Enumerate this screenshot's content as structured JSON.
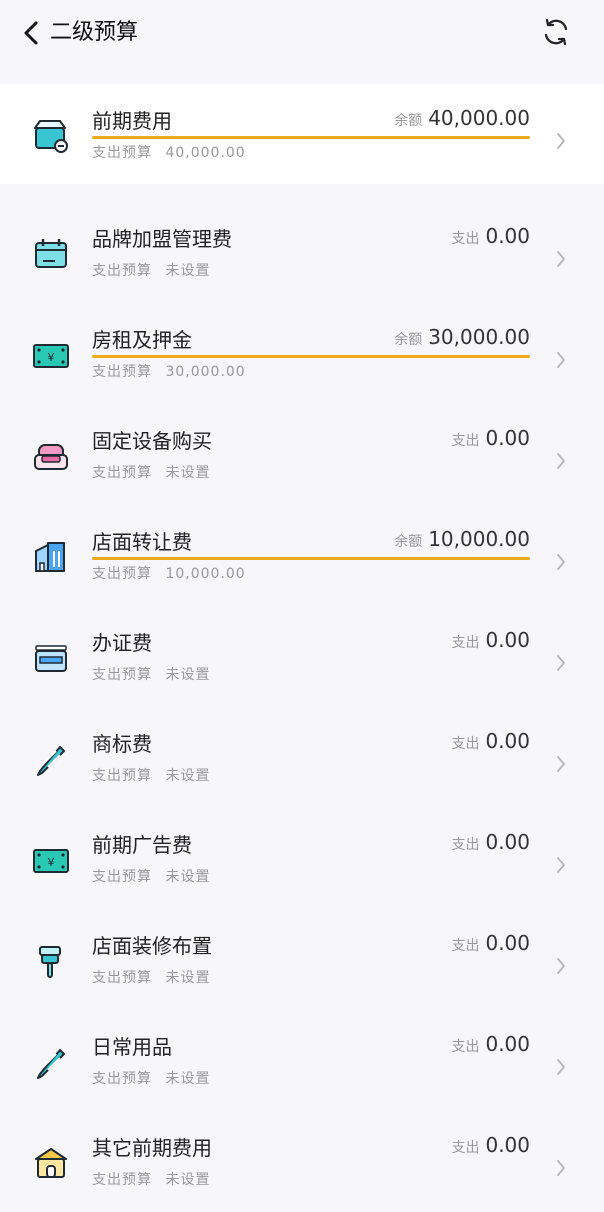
{
  "header": {
    "title": "二级预算"
  },
  "items": [
    {
      "name": "前期费用",
      "label": "余额",
      "amount": "40,000.00",
      "sub_label": "支出预算",
      "sub_value": "40,000.00",
      "has_progress": true,
      "progress": 1.0,
      "icon": "shop-icon",
      "color": "#38c6d3"
    },
    {
      "name": "品牌加盟管理费",
      "label": "支出",
      "amount": "0.00",
      "sub_label": "支出预算",
      "sub_value": "未设置",
      "has_progress": false,
      "icon": "calendar-icon",
      "color": "#38c6d3"
    },
    {
      "name": "房租及押金",
      "label": "余额",
      "amount": "30,000.00",
      "sub_label": "支出预算",
      "sub_value": "30,000.00",
      "has_progress": true,
      "progress": 1.0,
      "icon": "money-bill-icon",
      "color": "#29c9b6"
    },
    {
      "name": "固定设备购买",
      "label": "支出",
      "amount": "0.00",
      "sub_label": "支出预算",
      "sub_value": "未设置",
      "has_progress": false,
      "icon": "sofa-icon",
      "color": "#e86aa2"
    },
    {
      "name": "店面转让费",
      "label": "余额",
      "amount": "10,000.00",
      "sub_label": "支出预算",
      "sub_value": "10,000.00",
      "has_progress": true,
      "progress": 1.0,
      "icon": "building-icon",
      "color": "#4aa6f2"
    },
    {
      "name": "办证费",
      "label": "支出",
      "amount": "0.00",
      "sub_label": "支出预算",
      "sub_value": "未设置",
      "has_progress": false,
      "icon": "card-icon",
      "color": "#4aa6f2"
    },
    {
      "name": "商标费",
      "label": "支出",
      "amount": "0.00",
      "sub_label": "支出预算",
      "sub_value": "未设置",
      "has_progress": false,
      "icon": "pencil-icon",
      "color": "#38c6d3"
    },
    {
      "name": "前期广告费",
      "label": "支出",
      "amount": "0.00",
      "sub_label": "支出预算",
      "sub_value": "未设置",
      "has_progress": false,
      "icon": "money-bill-icon",
      "color": "#29c9b6"
    },
    {
      "name": "店面装修布置",
      "label": "支出",
      "amount": "0.00",
      "sub_label": "支出预算",
      "sub_value": "未设置",
      "has_progress": false,
      "icon": "paint-brush-icon",
      "color": "#38c6d3"
    },
    {
      "name": "日常用品",
      "label": "支出",
      "amount": "0.00",
      "sub_label": "支出预算",
      "sub_value": "未设置",
      "has_progress": false,
      "icon": "pencil-icon",
      "color": "#38c6d3"
    },
    {
      "name": "其它前期费用",
      "label": "支出",
      "amount": "0.00",
      "sub_label": "支出预算",
      "sub_value": "未设置",
      "has_progress": false,
      "icon": "house-icon",
      "color": "#f6c94a"
    }
  ],
  "colors": {
    "progress": "#f0a81c",
    "background": "#f7f7f9",
    "text_muted": "#9a9a9a"
  }
}
